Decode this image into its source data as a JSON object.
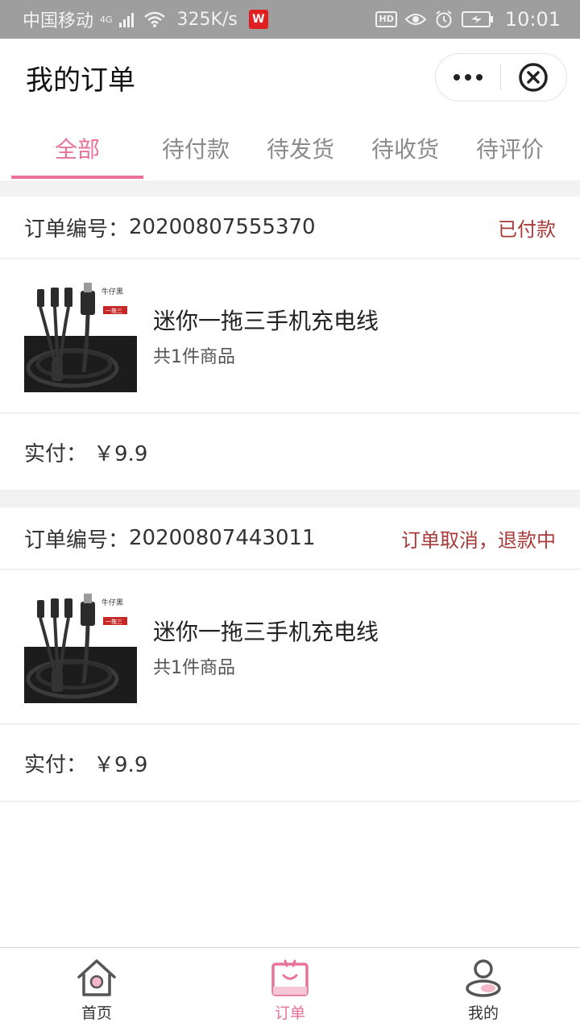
{
  "status_bar": {
    "carrier": "中国移动",
    "network": "4G",
    "speed": "325K/s",
    "app_badge": "W",
    "hd": "HD",
    "time": "10:01"
  },
  "nav": {
    "title": "我的订单"
  },
  "tabs": [
    {
      "label": "全部",
      "active": true
    },
    {
      "label": "待付款",
      "active": false
    },
    {
      "label": "待发货",
      "active": false
    },
    {
      "label": "待收货",
      "active": false
    },
    {
      "label": "待评价",
      "active": false
    }
  ],
  "orders": [
    {
      "number_label": "订单编号：",
      "number": "20200807555370",
      "status": "已付款",
      "product_name": "迷你一拖三手机充电线",
      "product_count": "共1件商品",
      "paid_label": "实付：",
      "paid_value": "￥9.9",
      "thumb_brand": "牛仔黑",
      "thumb_tag": "一拖三"
    },
    {
      "number_label": "订单编号：",
      "number": "20200807443011",
      "status": "订单取消，退款中",
      "product_name": "迷你一拖三手机充电线",
      "product_count": "共1件商品",
      "paid_label": "实付：",
      "paid_value": "￥9.9",
      "thumb_brand": "牛仔黑",
      "thumb_tag": "一拖三"
    }
  ],
  "tabbar": [
    {
      "label": "首页",
      "icon": "home-icon",
      "active": false
    },
    {
      "label": "订单",
      "icon": "order-icon",
      "active": true
    },
    {
      "label": "我的",
      "icon": "profile-icon",
      "active": false
    }
  ],
  "colors": {
    "accent": "#e8729a",
    "status_text": "#a83a3a",
    "status_bar_bg": "#9e9e9e"
  }
}
